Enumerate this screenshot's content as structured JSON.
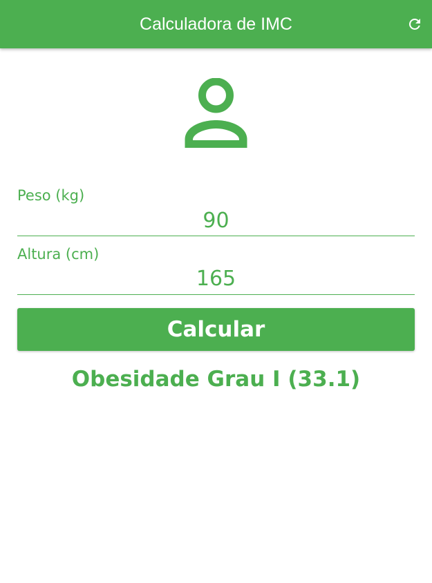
{
  "appbar": {
    "title": "Calculadora de IMC",
    "refresh_icon": "refresh-icon",
    "color": "#4CAF50"
  },
  "profile_icon": "person-outline-icon",
  "form": {
    "weight": {
      "label": "Peso (kg)",
      "value": "90"
    },
    "height": {
      "label": "Altura (cm)",
      "value": "165"
    }
  },
  "calculate_button": {
    "label": "Calcular"
  },
  "result": {
    "text": "Obesidade Grau I (33.1)"
  },
  "colors": {
    "accent": "#4CAF50",
    "background": "#FFFFFF",
    "on_accent": "#FFFFFF"
  }
}
